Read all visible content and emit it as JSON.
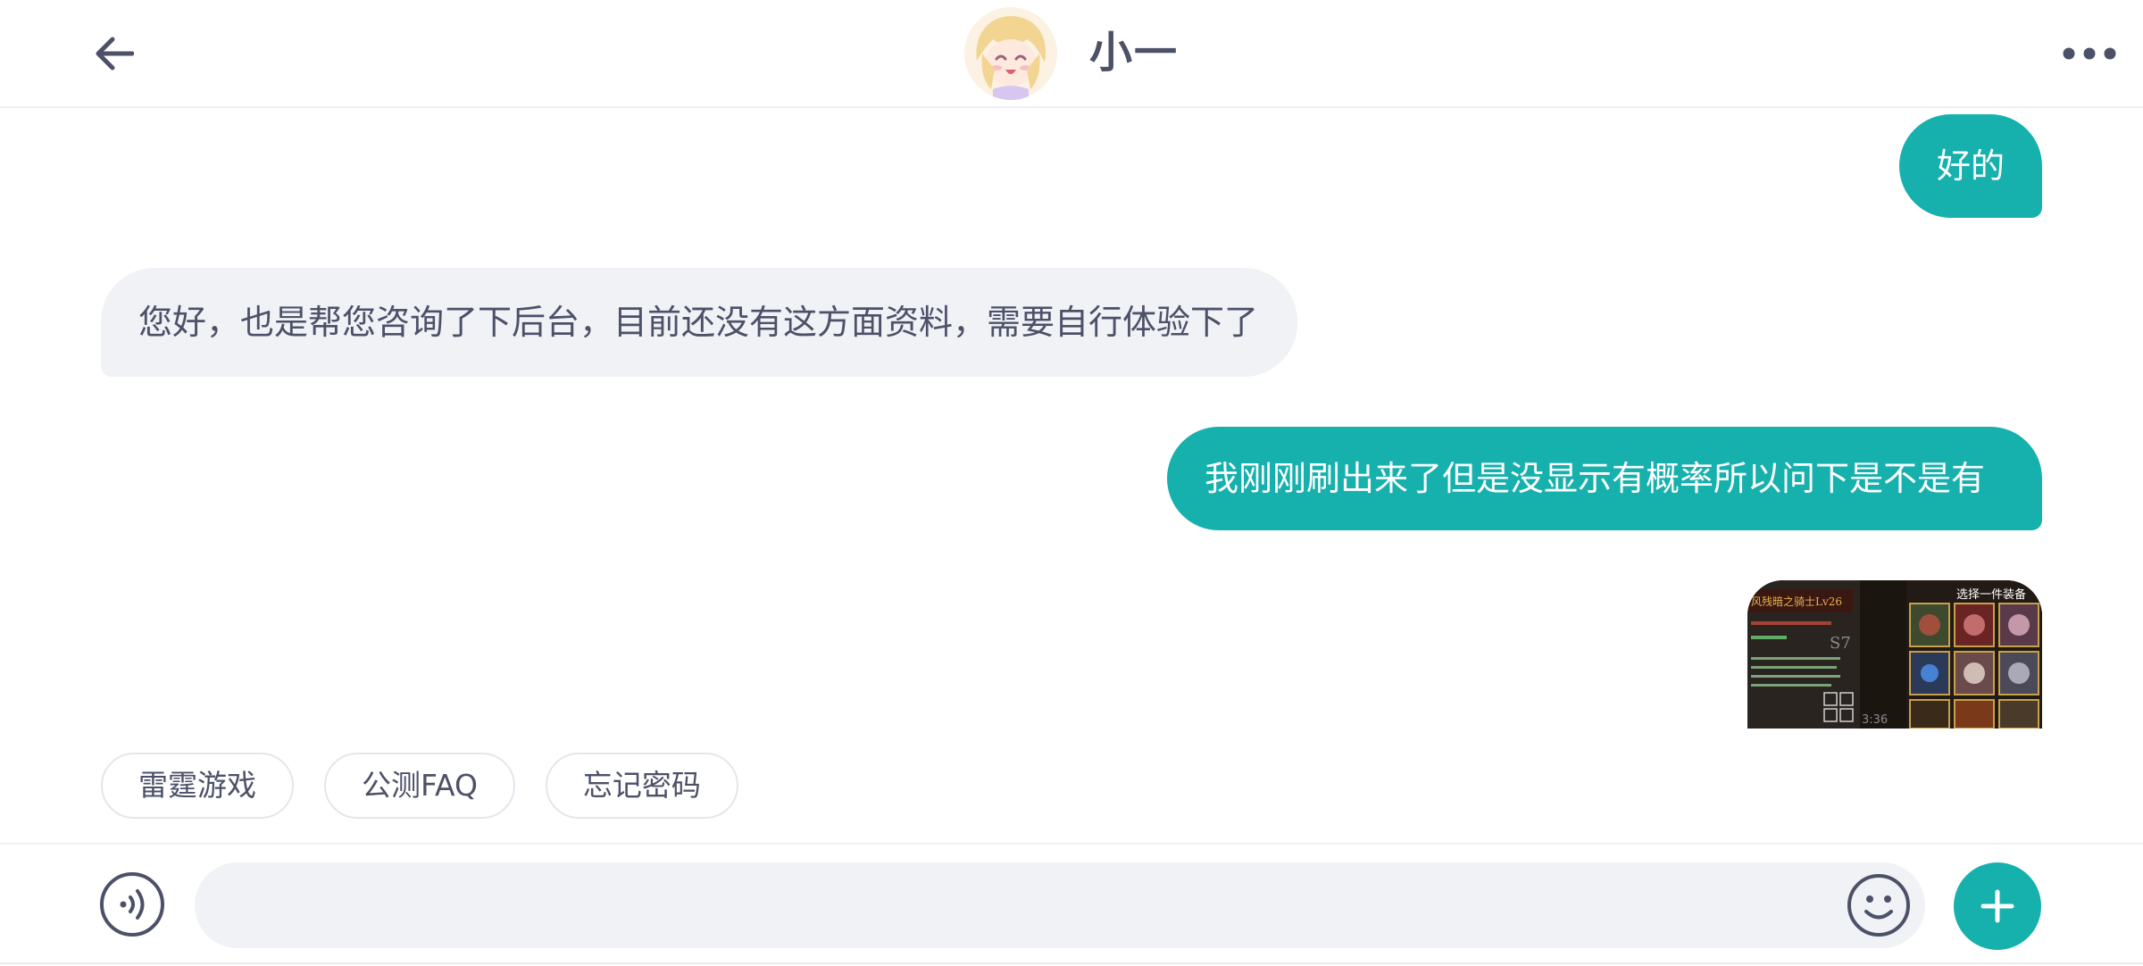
{
  "header": {
    "back_icon": "arrow-left-icon",
    "avatar_icon": "anime-girl-avatar",
    "contact_name": "小一",
    "more_icon": "more-horizontal-icon"
  },
  "messages": [
    {
      "side": "out",
      "text": "好的"
    },
    {
      "side": "in",
      "text": "您好，也是帮您咨询了下后台，目前还没有这方面资料，需要自行体验下了"
    },
    {
      "side": "out",
      "text": "我刚刚刷出来了但是没显示有概率所以问下是不是有"
    },
    {
      "side": "out",
      "type": "image",
      "image_texts": {
        "title": "选择一件装备",
        "hero_name": "风残暗之骑士Lv26",
        "timer": "3:36",
        "badge": "S7"
      }
    }
  ],
  "quick_replies": [
    "雷霆游戏",
    "公测FAQ",
    "忘记密码"
  ],
  "input_bar": {
    "voice_icon": "voice-input-icon",
    "placeholder": "",
    "emoji_icon": "smiley-icon",
    "plus_icon": "plus-icon"
  },
  "colors": {
    "accent": "#16b0ad",
    "incoming_bubble": "#f0f2f6",
    "text_primary": "#4d5168"
  }
}
